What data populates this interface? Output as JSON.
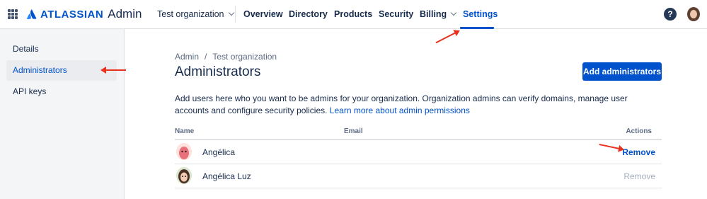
{
  "topnav": {
    "brand": "ATLASSIAN",
    "product": "Admin",
    "org_switcher": "Test organization",
    "items": [
      {
        "label": "Overview"
      },
      {
        "label": "Directory"
      },
      {
        "label": "Products"
      },
      {
        "label": "Security"
      },
      {
        "label": "Billing"
      },
      {
        "label": "Settings"
      }
    ],
    "help_glyph": "?"
  },
  "sidebar": {
    "items": [
      {
        "label": "Details"
      },
      {
        "label": "Administrators"
      },
      {
        "label": "API keys"
      }
    ]
  },
  "main": {
    "breadcrumb": [
      "Admin",
      "Test organization"
    ],
    "breadcrumb_sep": "/",
    "title": "Administrators",
    "add_button": "Add administrators",
    "description_text": "Add users here who you want to be admins for your organization. Organization admins can verify domains, manage user accounts and configure security policies.",
    "description_link": "Learn more about admin permissions",
    "table": {
      "headers": {
        "name": "Name",
        "email": "Email",
        "actions": "Actions"
      },
      "rows": [
        {
          "name": "Angélica",
          "action": "Remove",
          "action_enabled": true
        },
        {
          "name": "Angélica Luz",
          "action": "Remove",
          "action_enabled": false
        }
      ]
    }
  },
  "colors": {
    "accent": "#0052CC",
    "annotation": "#E8321E"
  }
}
